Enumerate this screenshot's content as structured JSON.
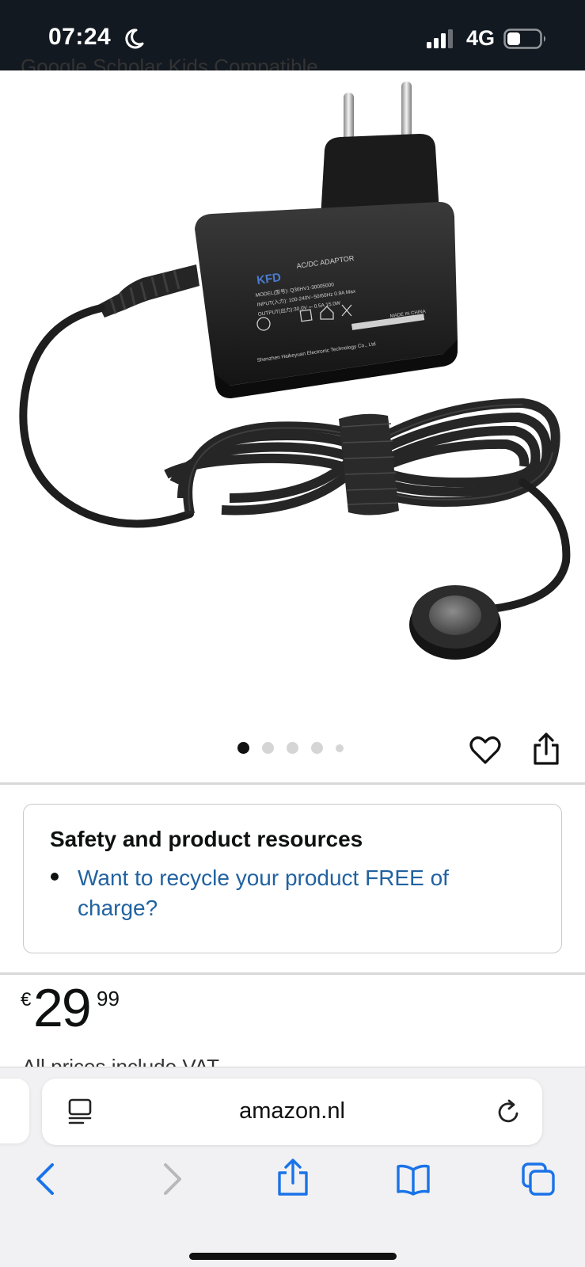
{
  "status_bar": {
    "time": "07:24",
    "network": "4G",
    "icons": [
      "moon-icon",
      "signal-icon",
      "battery-icon"
    ],
    "background": "#131921"
  },
  "header": {
    "clipped_text": "Google Scholar Kids Compatible"
  },
  "product_image": {
    "description_label": "AC/DC ADAPTOR",
    "brand_logo": "KFD",
    "label_lines": [
      "MODEL(型号): Q36HV1-30005000",
      "INPUT(入力): 100-240V~50/60Hz 0.9A Max",
      "OUTPUT(出力):30.0V ⎓ 0.5A 15.0W",
      "MADE IN CHINA",
      "Shenzhen Haikeyuan Electronic Technology Co., Ltd"
    ]
  },
  "carousel": {
    "dot_count": 5,
    "active_index": 0,
    "icons": [
      "heart-icon",
      "share-icon"
    ]
  },
  "safety": {
    "title": "Safety and product resources",
    "link_text": "Want to recycle your product FREE of charge?"
  },
  "price": {
    "currency": "€",
    "whole": "29",
    "fraction": "99",
    "vat_note": "All prices include VAT."
  },
  "browser": {
    "address": "amazon.nl",
    "icons": [
      "reader-icon",
      "reload-icon",
      "back-icon",
      "forward-icon",
      "share-icon",
      "bookmarks-icon",
      "tabs-icon"
    ],
    "accent": "#1a73e8"
  }
}
